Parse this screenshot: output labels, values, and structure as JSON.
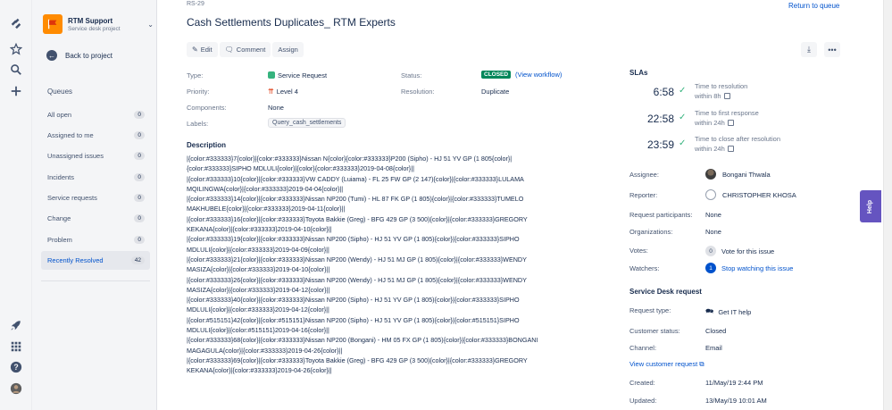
{
  "project": {
    "name": "RTM Support",
    "type": "Service desk project"
  },
  "sidebar": {
    "back_label": "Back to project",
    "queues_title": "Queues",
    "queues": [
      {
        "label": "All open",
        "count": "0"
      },
      {
        "label": "Assigned to me",
        "count": "0"
      },
      {
        "label": "Unassigned issues",
        "count": "0"
      },
      {
        "label": "Incidents",
        "count": "0"
      },
      {
        "label": "Service requests",
        "count": "0"
      },
      {
        "label": "Change",
        "count": "0"
      },
      {
        "label": "Problem",
        "count": "0"
      },
      {
        "label": "Recently Resolved",
        "count": "42"
      }
    ]
  },
  "issue": {
    "key": "RS-29",
    "title": "Cash Settlements Duplicates_ RTM Experts",
    "return_label": "Return to queue",
    "toolbar": {
      "edit": "Edit",
      "comment": "Comment",
      "assign": "Assign"
    },
    "fields": {
      "type_label": "Type:",
      "type_value": "Service Request",
      "priority_label": "Priority:",
      "priority_value": "Level 4",
      "components_label": "Components:",
      "components_value": "None",
      "labels_label": "Labels:",
      "labels_value": "Query_cash_settlements",
      "status_label": "Status:",
      "status_value": "CLOSED",
      "workflow_link": "(View workflow)",
      "resolution_label": "Resolution:",
      "resolution_value": "Duplicate"
    },
    "description_title": "Description",
    "description_lines": [
      "|{color:#333333}7{color}|{color:#333333}Nissan N{color}{color:#333333}P200 (Sipho) - HJ 51 YV GP (1 805{color}|",
      "{color:#333333}SIPHO MDLULI{color}|{color}{color:#333333}2019-04-08{color}||",
      "|{color:#333333}10{color}|{color:#333333}VW CADDY (Luiama) - FL 25 FW GP (2 147){color}|{color:#333333}LULAMA",
      "MQILINGWA{color}|{color:#333333}2019-04-04{color}||",
      "|{color:#333333}14{color}|{color:#333333}Nissan NP200 (Tumi) - HL 87 FK GP (1 805){color}|{color:#333333}TUMELO",
      "MAKHUBELE{color}|{color:#333333}2019-04-11{color}||",
      "|{color:#333333}16{color}|{color:#333333}Toyota Bakkie (Greg) - BFG 429 GP (3 500){color}|{color:#333333}GREGORY",
      "KEKANA{color}|{color:#333333}2019-04-10{color}||",
      "|{color:#333333}19{color}|{color:#333333}Nissan NP200 (Sipho) - HJ 51 YV GP (1 805){color}|{color:#333333}SIPHO",
      "MDLULI{color}|{color:#333333}2019-04-09{color}||",
      "|{color:#333333}21{color}|{color:#333333}Nissan NP200 (Wendy) - HJ 51 MJ GP (1 805){color}|{color:#333333}WENDY",
      "MASIZA{color}|{color:#333333}2019-04-10{color}||",
      "|{color:#333333}26{color}|{color:#333333}Nissan NP200 (Wendy) - HJ 51 MJ GP (1 805){color}|{color:#333333}WENDY",
      "MASIZA{color}|{color:#333333}2019-04-12{color}||",
      "|{color:#333333}40{color}|{color:#333333}Nissan NP200 (Sipho) - HJ 51 YV GP (1 805){color}|{color:#333333}SIPHO",
      "MDLULI{color}|{color:#333333}2019-04-12{color}||",
      "|{color:#515151}42{color}|{color:#515151}Nissan NP200 (Sipho) - HJ 51 YV GP (1 805){color}|{color:#515151}SIPHO",
      "MDLULI{color}|{color:#515151}2019-04-16{color}||",
      "|{color:#333333}68{color}|{color:#333333}Nissan NP200 (Bongani) - HM 05 FX GP (1 805){color}|{color:#333333}BONGANI",
      "MAGAGULA{color}|{color:#333333}2019-04-26{color}||",
      "|{color:#333333}69{color}|{color:#333333}Toyota Bakkie (Greg) - BFG 429 GP (3 500){color}|{color:#333333}GREGORY",
      "KEKANA{color}|{color:#333333}2019-04-26{color}||"
    ]
  },
  "slas": {
    "title": "SLAs",
    "items": [
      {
        "time": "6:58",
        "goal_line1": "Time to resolution",
        "goal_line2": "within 8h"
      },
      {
        "time": "22:58",
        "goal_line1": "Time to first response",
        "goal_line2": "within 24h"
      },
      {
        "time": "23:59",
        "goal_line1": "Time to close after resolution",
        "goal_line2": "within 24h"
      }
    ]
  },
  "people": {
    "assignee_label": "Assignee:",
    "assignee_value": "Bongani Thwala",
    "reporter_label": "Reporter:",
    "reporter_value": "CHRISTOPHER KHOSA",
    "participants_label": "Request participants:",
    "participants_value": "None",
    "orgs_label": "Organizations:",
    "orgs_value": "None",
    "votes_label": "Votes:",
    "votes_count": "0",
    "votes_text": "Vote for this issue",
    "watchers_label": "Watchers:",
    "watchers_count": "1",
    "watchers_text": "Stop watching this issue"
  },
  "service_desk": {
    "title": "Service Desk request",
    "request_type_label": "Request type:",
    "request_type_value": "Get IT help",
    "customer_status_label": "Customer status:",
    "customer_status_value": "Closed",
    "channel_label": "Channel:",
    "channel_value": "Email",
    "view_customer_request": "View customer request",
    "created_label": "Created:",
    "created_value": "11/May/19 2:44 PM",
    "updated_label": "Updated:",
    "updated_value": "13/May/19 10:01 AM"
  },
  "help_tab": "Help"
}
